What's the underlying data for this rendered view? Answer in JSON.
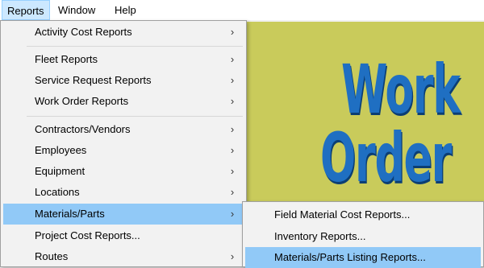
{
  "menubar": {
    "items": [
      {
        "label": "Reports"
      },
      {
        "label": "Window"
      },
      {
        "label": "Help"
      }
    ]
  },
  "banner": {
    "line1": "Work",
    "line2": "Order"
  },
  "reports_menu": {
    "items": [
      {
        "label": "Activity Cost Reports",
        "arrow": "›"
      },
      {
        "label": "Fleet Reports",
        "arrow": "›"
      },
      {
        "label": "Service Request Reports",
        "arrow": "›"
      },
      {
        "label": "Work Order Reports",
        "arrow": "›"
      },
      {
        "label": "Contractors/Vendors",
        "arrow": "›"
      },
      {
        "label": "Employees",
        "arrow": "›"
      },
      {
        "label": "Equipment",
        "arrow": "›"
      },
      {
        "label": "Locations",
        "arrow": "›"
      },
      {
        "label": "Materials/Parts",
        "arrow": "›"
      },
      {
        "label": "Project Cost Reports...",
        "arrow": ""
      },
      {
        "label": "Routes",
        "arrow": "›"
      }
    ]
  },
  "materials_submenu": {
    "items": [
      {
        "label": "Field Material Cost Reports..."
      },
      {
        "label": "Inventory Reports..."
      },
      {
        "label": "Materials/Parts Listing Reports..."
      }
    ]
  },
  "colors": {
    "menu_highlight": "#91c9f7",
    "menubar_active": "#cce8ff",
    "banner_text": "#1f6fc2",
    "banner_background": "#c9cb5b"
  }
}
